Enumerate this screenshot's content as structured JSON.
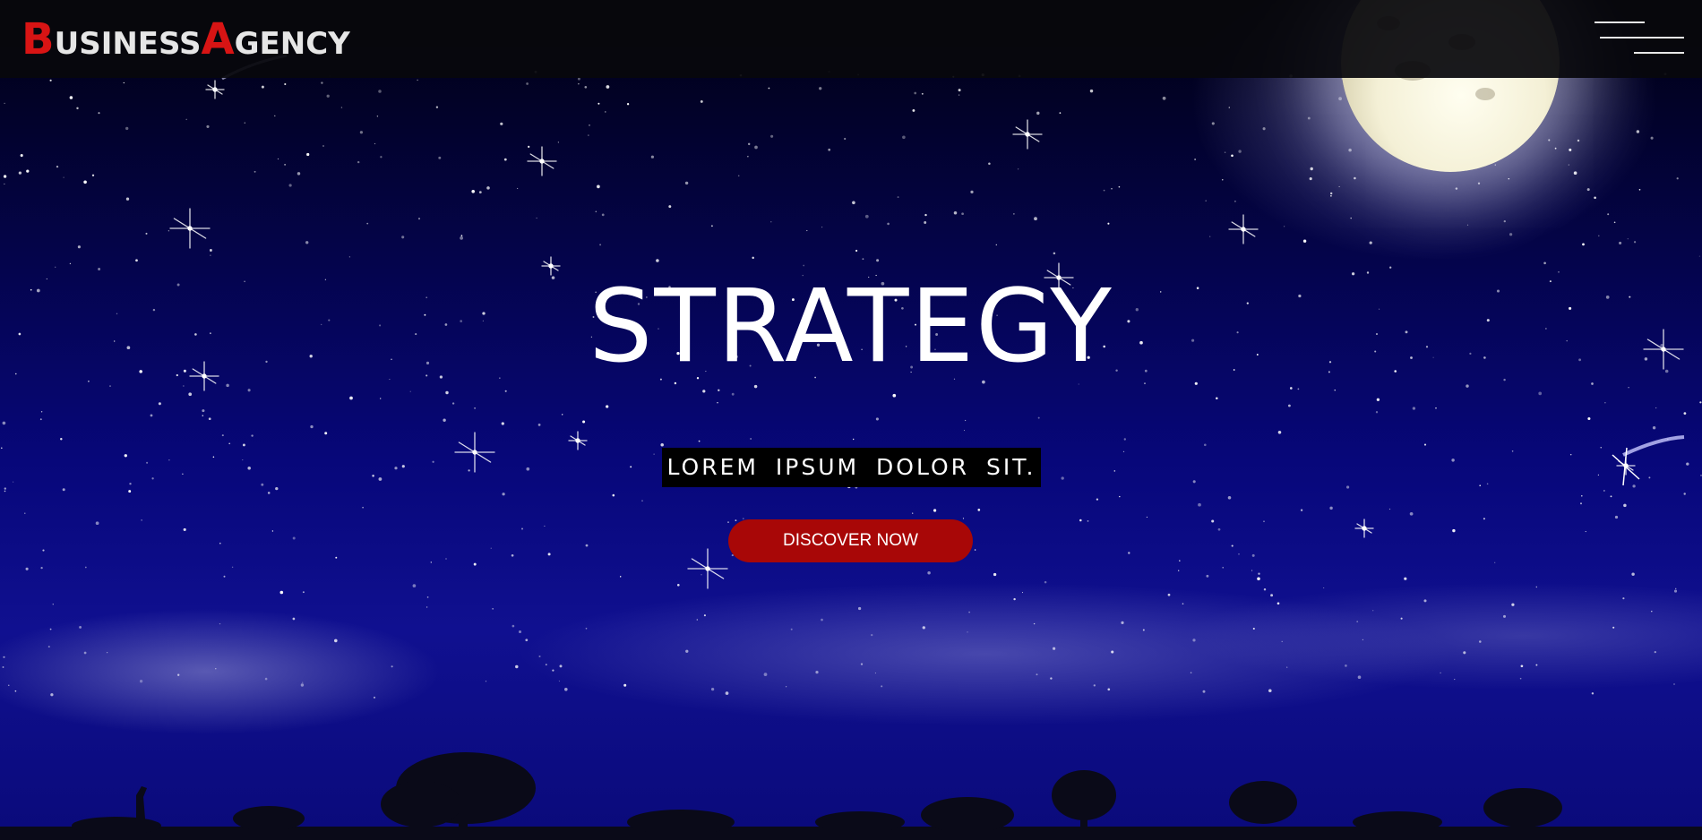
{
  "brand": {
    "logo_initial_1": "B",
    "logo_rest_1": "USINESS",
    "logo_initial_2": "A",
    "logo_rest_2": "GENCY",
    "accent_color": "#d81414"
  },
  "nav": {
    "menu_icon": "hamburger-menu-icon"
  },
  "hero": {
    "title": "STRATEGY",
    "subtitle": "LOREM IPSUM DOLOR SIT.",
    "cta_label": "DISCOVER NOW",
    "cta_color": "#a80707"
  },
  "background": {
    "scene": "night-sky",
    "elements": [
      "moon",
      "stars",
      "shooting-star",
      "savanna-silhouette"
    ]
  }
}
